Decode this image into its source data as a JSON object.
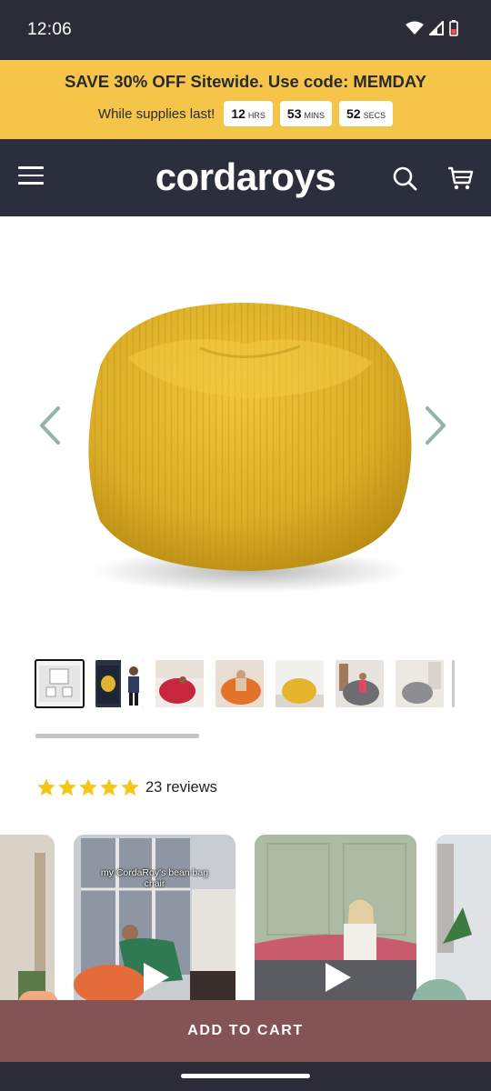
{
  "status_bar": {
    "time": "12:06"
  },
  "promo": {
    "headline": "SAVE 30% OFF Sitewide. Use code: MEMDAY",
    "subtext": "While supplies last!",
    "timer": [
      {
        "value": "12",
        "unit": "HRS"
      },
      {
        "value": "53",
        "unit": "MINS"
      },
      {
        "value": "52",
        "unit": "SECS"
      }
    ]
  },
  "header": {
    "logo": "cordaroys",
    "icons": [
      "menu-icon",
      "search-icon",
      "cart-icon"
    ]
  },
  "product": {
    "image_alt": "yellow corduroy bean bag chair",
    "thumbnails": [
      "thumb-1",
      "thumb-2",
      "thumb-3",
      "thumb-4",
      "thumb-5",
      "thumb-6",
      "thumb-7"
    ],
    "rating": {
      "stars": 5,
      "count_label": "23 reviews"
    }
  },
  "videos": [
    {
      "caption": "my CordaRoy's bean bag chair"
    },
    {
      "caption": ""
    }
  ],
  "cta": {
    "add_to_cart": "ADD TO CART"
  },
  "colors": {
    "promo_bg": "#f5c54a",
    "nav_bg": "#2b2e3d",
    "cta_bg": "#845356",
    "product_yellow": "#e0b22a",
    "star": "#f5c518"
  }
}
